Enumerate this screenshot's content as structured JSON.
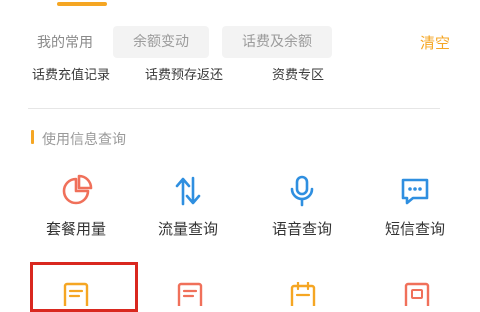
{
  "tabs": {
    "active_underline_color": "#f5a623"
  },
  "history": {
    "label": "我的常用",
    "chips": [
      "余额变动",
      "话费及余额"
    ],
    "clear_label": "清空"
  },
  "recent_items": [
    "话费充值记录",
    "话费预存返还",
    "资费专区"
  ],
  "section": {
    "title": "使用信息查询"
  },
  "services_row1": [
    {
      "label": "套餐用量",
      "icon": "pie-chart-icon"
    },
    {
      "label": "流量查询",
      "icon": "up-down-arrows-icon"
    },
    {
      "label": "语音查询",
      "icon": "microphone-icon"
    },
    {
      "label": "短信查询",
      "icon": "message-icon"
    }
  ],
  "services_row2_icons": [
    "bill-icon",
    "document-icon",
    "calendar-icon",
    "record-icon"
  ],
  "colors": {
    "accent": "#f5a623",
    "icon_blue": "#2f8fe0",
    "icon_red": "#f0705a",
    "highlight": "#d9281f"
  }
}
